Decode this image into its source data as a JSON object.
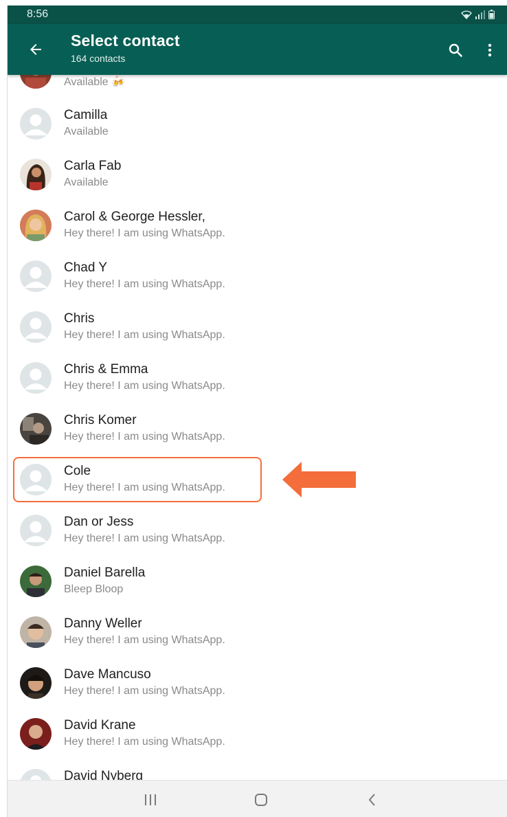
{
  "status_bar": {
    "time": "8:56"
  },
  "header": {
    "title": "Select contact",
    "subtitle": "164 contacts"
  },
  "icons": {
    "back": "arrow-back-icon",
    "search": "search-icon",
    "menu": "more-vert-icon"
  },
  "colors": {
    "header": "#075e54",
    "status_bar": "#0a5148",
    "highlight": "#f36e3a"
  },
  "contacts": [
    {
      "name": "",
      "status": "Available 🍻",
      "avatar": "photo"
    },
    {
      "name": "Camilla",
      "status": "Available",
      "avatar": "default"
    },
    {
      "name": "Carla Fab",
      "status": "Available",
      "avatar": "photo"
    },
    {
      "name": "Carol & George Hessler,",
      "status": "Hey there! I am using WhatsApp.",
      "avatar": "photo"
    },
    {
      "name": "Chad Y",
      "status": "Hey there! I am using WhatsApp.",
      "avatar": "default"
    },
    {
      "name": "Chris",
      "status": "Hey there! I am using WhatsApp.",
      "avatar": "default"
    },
    {
      "name": "Chris & Emma",
      "status": "Hey there! I am using WhatsApp.",
      "avatar": "default"
    },
    {
      "name": "Chris Komer",
      "status": "Hey there! I am using WhatsApp.",
      "avatar": "photo"
    },
    {
      "name": "Cole",
      "status": "Hey there! I am using WhatsApp.",
      "avatar": "default",
      "highlighted": true
    },
    {
      "name": "Dan or Jess",
      "status": "Hey there! I am using WhatsApp.",
      "avatar": "default"
    },
    {
      "name": "Daniel Barella",
      "status": "Bleep Bloop",
      "avatar": "photo"
    },
    {
      "name": "Danny Weller",
      "status": "Hey there! I am using WhatsApp.",
      "avatar": "photo"
    },
    {
      "name": "Dave Mancuso",
      "status": "Hey there! I am using WhatsApp.",
      "avatar": "photo"
    },
    {
      "name": "David Krane",
      "status": "Hey there! I am using WhatsApp.",
      "avatar": "photo"
    },
    {
      "name": "David Nyberg",
      "status": "",
      "avatar": "default"
    }
  ],
  "nav": {
    "recents": "recents-icon",
    "home": "home-icon",
    "back": "nav-back-icon"
  }
}
